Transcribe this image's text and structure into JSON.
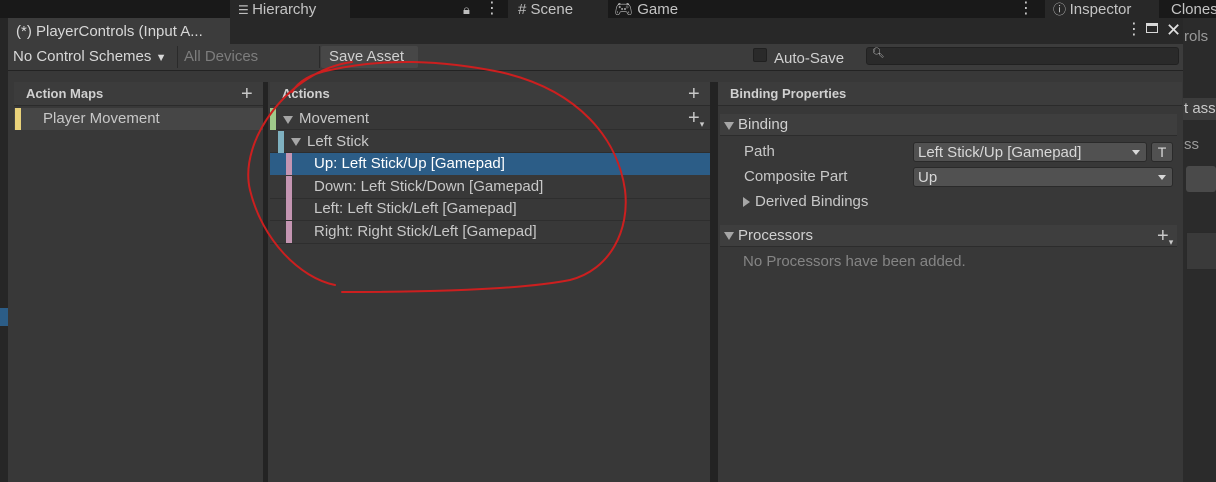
{
  "background": {
    "tabs": [
      "Hierarchy",
      "Scene",
      "Game",
      "Inspector",
      "Clones"
    ],
    "right_peek": [
      "rols",
      "t ass",
      "ss"
    ]
  },
  "window": {
    "title": "(*) PlayerControls (Input A...",
    "toolbar": {
      "control_schemes": "No Control Schemes",
      "devices": "All Devices",
      "save_asset": "Save Asset",
      "auto_save": "Auto-Save",
      "search_placeholder": ""
    }
  },
  "action_maps": {
    "header": "Action Maps",
    "items": [
      {
        "label": "Player Movement",
        "color": "#e9d27a"
      }
    ]
  },
  "actions": {
    "header": "Actions",
    "action": {
      "label": "Movement",
      "color": "#9fc98a"
    },
    "composite": {
      "label": "Left Stick",
      "color": "#7fb1c0"
    },
    "bindings": [
      {
        "label": "Up: Left Stick/Up [Gamepad]",
        "selected": true
      },
      {
        "label": "Down: Left Stick/Down [Gamepad]",
        "selected": false
      },
      {
        "label": "Left: Left Stick/Left [Gamepad]",
        "selected": false
      },
      {
        "label": "Right: Right Stick/Left [Gamepad]",
        "selected": false
      }
    ],
    "binding_color": "#c495b2"
  },
  "binding_properties": {
    "header": "Binding Properties",
    "binding_section": "Binding",
    "path_label": "Path",
    "path_value": "Left Stick/Up [Gamepad]",
    "t_button": "T",
    "composite_part_label": "Composite Part",
    "composite_part_value": "Up",
    "derived_bindings": "Derived Bindings",
    "processors_section": "Processors",
    "no_processors": "No Processors have been added."
  },
  "colors": {
    "selection": "#2c5d87",
    "annotation": "#cc1f1f"
  }
}
